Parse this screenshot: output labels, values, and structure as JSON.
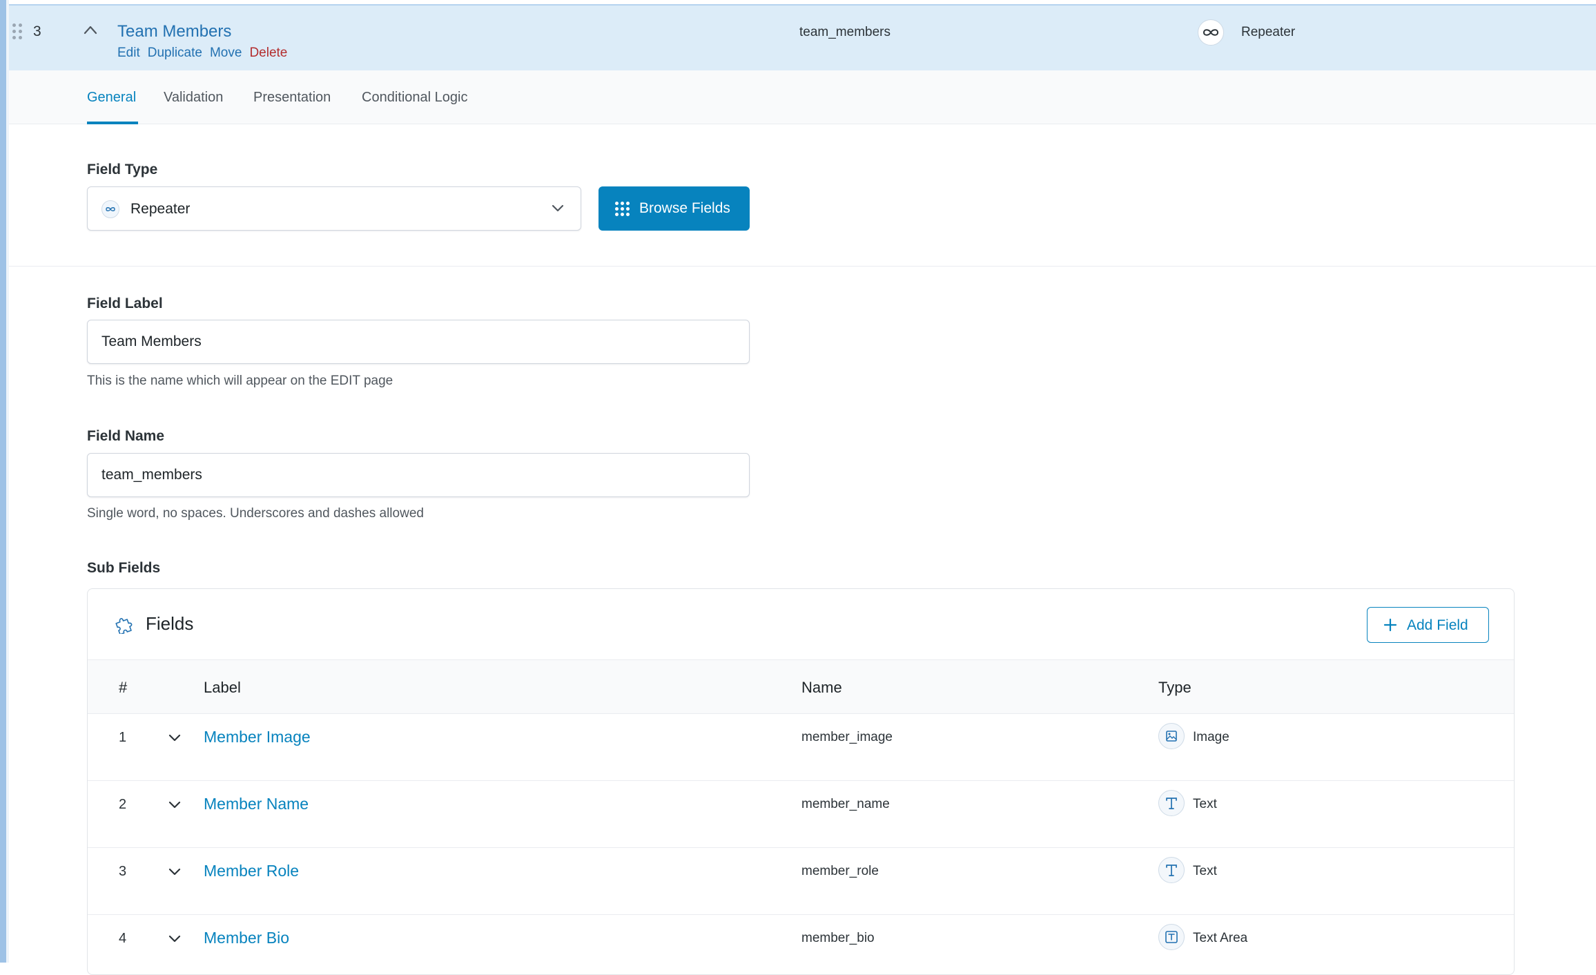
{
  "header": {
    "order": "3",
    "title": "Team Members",
    "actions": {
      "edit": "Edit",
      "duplicate": "Duplicate",
      "move": "Move",
      "delete": "Delete"
    },
    "name": "team_members",
    "type": "Repeater"
  },
  "tabs": [
    "General",
    "Validation",
    "Presentation",
    "Conditional Logic"
  ],
  "field_type": {
    "label": "Field Type",
    "value": "Repeater",
    "browse_label": "Browse Fields"
  },
  "field_label": {
    "label": "Field Label",
    "value": "Team Members",
    "help": "This is the name which will appear on the EDIT page"
  },
  "field_name": {
    "label": "Field Name",
    "value": "team_members",
    "help": "Single word, no spaces. Underscores and dashes allowed"
  },
  "sub_fields": {
    "label": "Sub Fields",
    "title": "Fields",
    "add_label": "Add Field",
    "columns": {
      "num": "#",
      "label": "Label",
      "name": "Name",
      "type": "Type"
    },
    "rows": [
      {
        "num": "1",
        "label": "Member Image",
        "name": "member_image",
        "type": "Image",
        "icon": "image-icon"
      },
      {
        "num": "2",
        "label": "Member Name",
        "name": "member_name",
        "type": "Text",
        "icon": "text-icon"
      },
      {
        "num": "3",
        "label": "Member Role",
        "name": "member_role",
        "type": "Text",
        "icon": "text-icon"
      },
      {
        "num": "4",
        "label": "Member Bio",
        "name": "member_bio",
        "type": "Text Area",
        "icon": "textarea-icon"
      }
    ]
  },
  "colors": {
    "accent": "#0783be",
    "link": "#2271b1",
    "danger": "#b32d2e",
    "header_bg": "#dcecf8"
  }
}
